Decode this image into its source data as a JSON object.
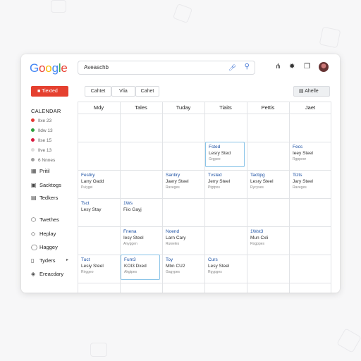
{
  "app": {
    "logo": [
      "G",
      "o",
      "o",
      "g",
      "l",
      "e"
    ],
    "logo_colors": [
      "#4285f4",
      "#ea4335",
      "#fbbc05",
      "#4285f4",
      "#34a853",
      "#ea4335"
    ]
  },
  "search": {
    "value": "Aveaschb"
  },
  "icons": {
    "mic": "mic-icon",
    "search": "search-icon",
    "add": "add-icon",
    "settings": "settings-icon",
    "copy": "copy-icon"
  },
  "toolbar": {
    "create_label": "Tiexted",
    "views": [
      "Cahtet",
      "Vlia",
      "Cahet"
    ],
    "schedule_label": "Ahelle"
  },
  "sidebar": {
    "title": "CALENDAR",
    "calendars": [
      {
        "label": "Ilxe 23",
        "color": "#e53935"
      },
      {
        "label": "Ildw 13",
        "color": "#2e9e3e"
      },
      {
        "label": "Ilse 15",
        "color": "#d81b40"
      },
      {
        "label": "Ilve 13",
        "color": "#dddddd"
      },
      {
        "label": "6 Nnnes",
        "color": "#9e9e9e"
      }
    ],
    "nav": [
      {
        "icon": "calendar-icon",
        "glyph": "▦",
        "label": "Pritil"
      },
      {
        "icon": "tasks-icon",
        "glyph": "▣",
        "label": "Sacktogs"
      },
      {
        "icon": "list-icon",
        "glyph": "▤",
        "label": "Tedkers"
      },
      {
        "icon": "shield-icon",
        "glyph": "⬡",
        "label": "Twethes"
      },
      {
        "icon": "bell-icon",
        "glyph": "◇",
        "label": "Heplay"
      },
      {
        "icon": "circle-icon",
        "glyph": "◯",
        "label": "Haggey"
      },
      {
        "icon": "doc-icon",
        "glyph": "▯",
        "label": "Tyders"
      },
      {
        "icon": "pin-icon",
        "glyph": "◈",
        "label": "Ereacdary"
      }
    ]
  },
  "grid": {
    "headers": [
      "Mdy",
      "Tales",
      "Tuday",
      "Tiaits",
      "Pettis",
      "Jaet"
    ],
    "events": [
      {
        "col": 3,
        "row": 1,
        "title": "Fsted",
        "sub": "Lesry Sted",
        "meta": "Grgpee",
        "boxed": true
      },
      {
        "col": 5,
        "row": 1,
        "title": "Fecs",
        "sub": "Ieey Steel",
        "meta": "Rgppeor",
        "boxed": false
      },
      {
        "col": 0,
        "row": 2,
        "title": "Festiry",
        "sub": "Larry Oadd",
        "meta": "Puiygei",
        "boxed": false
      },
      {
        "col": 2,
        "row": 2,
        "title": "Santiry",
        "sub": "Jaery Steel",
        "meta": "Raveges",
        "boxed": false
      },
      {
        "col": 3,
        "row": 2,
        "title": "Tvsted",
        "sub": "Jerry Steel",
        "meta": "Ptgtpos",
        "boxed": false
      },
      {
        "col": 4,
        "row": 2,
        "title": "Tactipg",
        "sub": "Lesry Steel",
        "meta": "Rycyses",
        "boxed": false
      },
      {
        "col": 5,
        "row": 2,
        "title": "Tizts",
        "sub": "Jary Steel",
        "meta": "Raveges",
        "boxed": false
      },
      {
        "col": 0,
        "row": 3,
        "title": "Tsct",
        "sub": "Lesy Stay",
        "meta": "",
        "boxed": false
      },
      {
        "col": 1,
        "row": 3,
        "title": "1Ws",
        "sub": "Fiio Gayj",
        "meta": "",
        "boxed": false
      },
      {
        "col": 1,
        "row": 4,
        "title": "Fnena",
        "sub": "Iesy Steel",
        "meta": "Anyggen",
        "boxed": false
      },
      {
        "col": 2,
        "row": 4,
        "title": "Noend",
        "sub": "Larn Cary",
        "meta": "Ruweles",
        "boxed": false
      },
      {
        "col": 4,
        "row": 4,
        "title": "1Wst3",
        "sub": "Mun Cxli",
        "meta": "Rogppes",
        "boxed": false
      },
      {
        "col": 0,
        "row": 5,
        "title": "Tuct",
        "sub": "Lesiy Steel",
        "meta": "Rirggeo",
        "boxed": false
      },
      {
        "col": 1,
        "row": 5,
        "title": "Fum3",
        "sub": "KOI3 Dxed",
        "meta": "Akgtpes",
        "boxed": true
      },
      {
        "col": 2,
        "row": 5,
        "title": "Toy",
        "sub": "Mbn CU2",
        "meta": "Gagypes",
        "boxed": false
      },
      {
        "col": 3,
        "row": 5,
        "title": "Curs",
        "sub": "Lesy Steel",
        "meta": "Rgypges",
        "boxed": false
      }
    ]
  }
}
